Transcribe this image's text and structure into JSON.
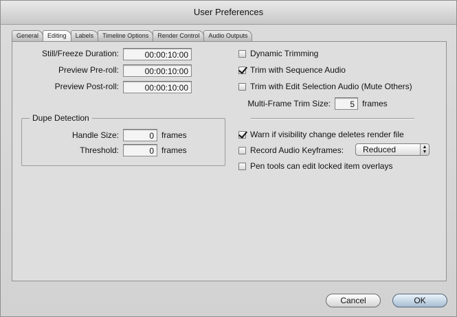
{
  "window": {
    "title": "User Preferences"
  },
  "tabs": [
    {
      "label": "General",
      "active": false
    },
    {
      "label": "Editing",
      "active": true
    },
    {
      "label": "Labels",
      "active": false
    },
    {
      "label": "Timeline Options",
      "active": false
    },
    {
      "label": "Render Control",
      "active": false
    },
    {
      "label": "Audio Outputs",
      "active": false
    }
  ],
  "left": {
    "still_freeze_label": "Still/Freeze Duration:",
    "still_freeze_value": "00:00:10:00",
    "preroll_label": "Preview Pre-roll:",
    "preroll_value": "00:00:10:00",
    "postroll_label": "Preview Post-roll:",
    "postroll_value": "00:00:10:00",
    "dupe": {
      "title": "Dupe Detection",
      "handle_label": "Handle Size:",
      "handle_value": "0",
      "handle_unit": "frames",
      "threshold_label": "Threshold:",
      "threshold_value": "0",
      "threshold_unit": "frames"
    }
  },
  "right": {
    "dynamic_trimming": {
      "label": "Dynamic Trimming",
      "checked": false
    },
    "trim_sequence_audio": {
      "label": "Trim with Sequence Audio",
      "checked": true
    },
    "trim_edit_selection": {
      "label": "Trim with Edit Selection Audio (Mute Others)",
      "checked": false
    },
    "multiframe_label": "Multi-Frame Trim Size:",
    "multiframe_value": "5",
    "multiframe_unit": "frames",
    "warn_visibility": {
      "label": "Warn if visibility change deletes render file",
      "checked": true
    },
    "record_audio_keyframes": {
      "label": "Record Audio Keyframes:",
      "checked": false
    },
    "record_audio_select": "Reduced",
    "pen_tools": {
      "label": "Pen tools can edit locked item overlays",
      "checked": false
    }
  },
  "buttons": {
    "cancel": "Cancel",
    "ok": "OK"
  }
}
